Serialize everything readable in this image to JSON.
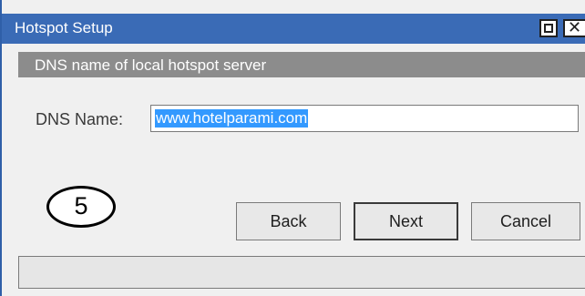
{
  "window": {
    "title": "Hotspot Setup",
    "maximize_icon": "maximize-icon",
    "close_icon": "close-icon",
    "title_bar_color": "#3a6bb6"
  },
  "section": {
    "header": "DNS name of local hotspot server"
  },
  "form": {
    "dns_label": "DNS Name:",
    "dns_value": "www.hotelparami.com"
  },
  "annotation": {
    "step_number": "5"
  },
  "buttons": {
    "back": "Back",
    "next": "Next",
    "cancel": "Cancel"
  },
  "status_bar": {
    "text": ""
  }
}
